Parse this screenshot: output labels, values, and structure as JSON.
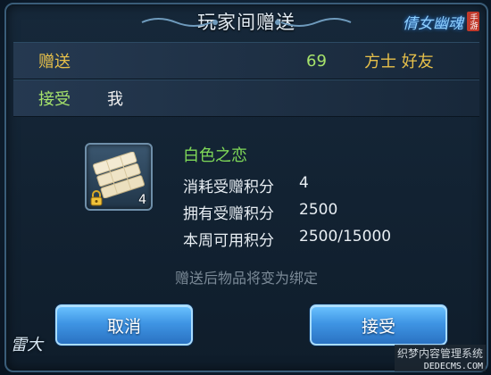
{
  "dialog": {
    "title": "玩家间赠送",
    "logo_text": "倩女幽魂",
    "logo_seal": "手游"
  },
  "gift_row": {
    "label": "赠送",
    "points": "69",
    "friend": "方士 好友"
  },
  "receive_row": {
    "label": "接受",
    "receiver": "我"
  },
  "item": {
    "name": "白色之恋",
    "quantity": "4",
    "icon": "white-chocolate-bars",
    "locked": true
  },
  "stats": [
    {
      "label": "消耗受赠积分",
      "value": "4"
    },
    {
      "label": "拥有受赠积分",
      "value": "2500"
    },
    {
      "label": "本周可用积分",
      "value": "2500/15000"
    }
  ],
  "note": "赠送后物品将变为绑定",
  "buttons": {
    "cancel": "取消",
    "accept": "接受"
  },
  "corner_logo": "雷大",
  "watermark": {
    "line1": "织梦内容管理系统",
    "line2": "DEDECMS.COM"
  },
  "colors": {
    "gold_text": "#e8c14a",
    "green_text": "#a6e36b",
    "item_name": "#7fd958",
    "button_blue": "#3f95e4"
  }
}
